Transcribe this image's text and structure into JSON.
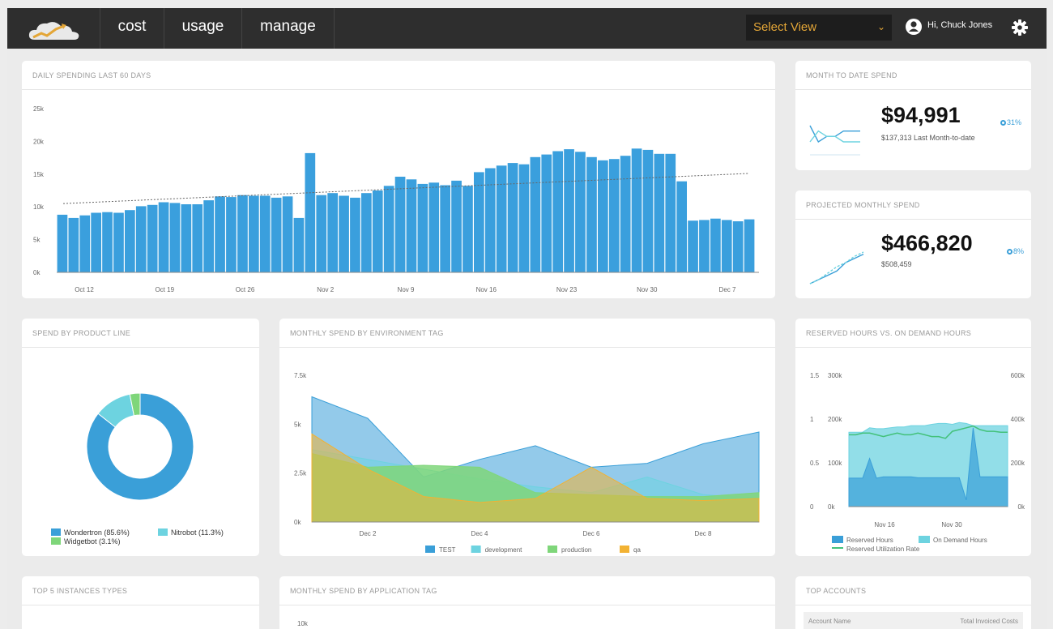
{
  "nav": {
    "items": [
      "cost",
      "usage",
      "manage"
    ],
    "select_view": "Select View",
    "user_greeting": "Hi, Chuck Jones",
    "icons": {
      "logo": "cloud-chart-logo",
      "avatar": "user-icon",
      "settings": "gear-icon",
      "dropdown": "chevron-down-icon"
    }
  },
  "cards": {
    "daily": {
      "title": "DAILY SPENDING LAST 60 DAYS"
    },
    "mtd": {
      "title": "MONTH TO DATE SPEND",
      "value": "$94,991",
      "sub": "$137,313 Last Month-to-date",
      "change": "31%"
    },
    "projected": {
      "title": "PROJECTED MONTHLY SPEND",
      "value": "$466,820",
      "sub": "$508,459",
      "change": "8%"
    },
    "product": {
      "title": "SPEND BY PRODUCT LINE"
    },
    "env": {
      "title": "MONTHLY SPEND BY ENVIRONMENT TAG"
    },
    "reserved": {
      "title": "RESERVED HOURS VS. ON DEMAND HOURS"
    },
    "instances": {
      "title": "TOP 5 INSTANCES TYPES"
    },
    "app": {
      "title": "MONTHLY SPEND BY APPLICATION TAG",
      "ytick": "10k"
    },
    "accounts": {
      "title": "TOP ACCOUNTS",
      "col1": "Account Name",
      "col2": "Total Invoiced Costs"
    }
  },
  "colors": {
    "bar": "#3a9fdd",
    "topbar": "#2e2e2e",
    "accent": "#e4a637",
    "test": "#3a9fd8",
    "development": "#6dd3e0",
    "production": "#7fd67a",
    "qa": "#f2b233"
  },
  "chart_data": [
    {
      "type": "bar",
      "title": "DAILY SPENDING LAST 60 DAYS",
      "yticks": [
        "25k",
        "20k",
        "15k",
        "10k",
        "5k",
        "0k"
      ],
      "ylim": [
        0,
        25000
      ],
      "xticks": [
        "Oct 12",
        "Oct 19",
        "Oct 26",
        "Nov 2",
        "Nov 9",
        "Nov 16",
        "Nov 23",
        "Nov 30",
        "Dec 7"
      ],
      "values": [
        8800,
        8300,
        8700,
        9100,
        9200,
        9100,
        9500,
        10100,
        10300,
        10700,
        10600,
        10400,
        10400,
        11000,
        11600,
        11500,
        11800,
        11700,
        11700,
        11400,
        11600,
        8300,
        18200,
        11800,
        12100,
        11700,
        11400,
        12100,
        12500,
        13200,
        14600,
        14200,
        13500,
        13700,
        13300,
        14000,
        13200,
        15300,
        15900,
        16300,
        16700,
        16500,
        17600,
        18000,
        18500,
        18800,
        18400,
        17600,
        17100,
        17300,
        17800,
        18900,
        18700,
        18100,
        18100,
        13900,
        7900,
        8000,
        8200,
        8000,
        7800,
        8100
      ],
      "trendline": [
        10500,
        15100
      ]
    },
    {
      "type": "line",
      "title": "MONTH TO DATE SPEND",
      "series": [
        {
          "values": [
            6,
            3,
            4,
            4,
            5,
            5,
            5
          ]
        },
        {
          "values": [
            3,
            5,
            4,
            4,
            3,
            3,
            3
          ]
        }
      ]
    },
    {
      "type": "line",
      "title": "PROJECTED MONTHLY SPEND",
      "series": [
        {
          "values": [
            1,
            2,
            3,
            4,
            6,
            7,
            8
          ]
        },
        {
          "values": [
            1,
            2,
            3.5,
            5,
            6,
            7.5,
            8.5
          ]
        }
      ]
    },
    {
      "type": "pie",
      "title": "SPEND BY PRODUCT LINE",
      "slices": [
        {
          "name": "Wondertron (85.6%)",
          "value": 85.6,
          "color": "#3a9fd8"
        },
        {
          "name": "Nitrobot (11.3%)",
          "value": 11.3,
          "color": "#6dd3e0"
        },
        {
          "name": "Widgetbot (3.1%)",
          "value": 3.1,
          "color": "#7fd67a"
        }
      ]
    },
    {
      "type": "area",
      "title": "MONTHLY SPEND BY ENVIRONMENT TAG",
      "yticks": [
        "7.5k",
        "5k",
        "2.5k",
        "0k"
      ],
      "ylim": [
        0,
        7500
      ],
      "x": [
        "Dec 1",
        "Dec 2",
        "Dec 3",
        "Dec 4",
        "Dec 5",
        "Dec 6",
        "Dec 7",
        "Dec 8",
        "Dec 9"
      ],
      "xticks": [
        "Dec 2",
        "Dec 4",
        "Dec 6",
        "Dec 8"
      ],
      "series": [
        {
          "name": "TEST",
          "color": "#3a9fd8",
          "values": [
            6400,
            5300,
            2300,
            3200,
            3900,
            2800,
            3000,
            4000,
            4600
          ]
        },
        {
          "name": "development",
          "color": "#6dd3e0",
          "values": [
            3700,
            3200,
            2700,
            2200,
            1800,
            1500,
            2300,
            1400,
            1200
          ]
        },
        {
          "name": "production",
          "color": "#7fd67a",
          "values": [
            3500,
            2800,
            2900,
            2800,
            1500,
            1400,
            1300,
            1300,
            1500
          ]
        },
        {
          "name": "qa",
          "color": "#f2b233",
          "values": [
            4500,
            2700,
            1300,
            1000,
            1200,
            2800,
            1200,
            1100,
            1200
          ]
        }
      ]
    },
    {
      "type": "area",
      "title": "RESERVED HOURS VS. ON DEMAND HOURS",
      "yticks_left_rate": [
        "1.5",
        "1",
        "0.5",
        "0"
      ],
      "yticks_left": [
        "300k",
        "200k",
        "100k",
        "0k"
      ],
      "yticks_right": [
        "600k",
        "400k",
        "200k",
        "0k"
      ],
      "xticks": [
        "Nov 16",
        "Nov 30"
      ],
      "series": [
        {
          "name": "Reserved Hours",
          "color": "#3a9fd8",
          "values": [
            65000,
            65000,
            65000,
            110000,
            65000,
            68000,
            68000,
            68000,
            68000,
            68000,
            66000,
            66000,
            66000,
            66000,
            66000,
            66000,
            66000,
            15000,
            180000,
            68000,
            68000,
            68000,
            68000,
            68000
          ]
        },
        {
          "name": "On Demand Hours",
          "color": "#6dd3e0",
          "values": [
            170000,
            170000,
            170000,
            180000,
            178000,
            178000,
            180000,
            182000,
            182000,
            185000,
            185000,
            185000,
            188000,
            190000,
            190000,
            188000,
            192000,
            190000,
            185000,
            185000,
            185000,
            185000,
            185000,
            185000
          ]
        },
        {
          "name": "Reserved Utilization Rate",
          "color": "#43c17a",
          "values": [
            0.82,
            0.82,
            0.84,
            0.84,
            0.82,
            0.8,
            0.82,
            0.84,
            0.82,
            0.82,
            0.84,
            0.82,
            0.8,
            0.8,
            0.78,
            0.86,
            0.88,
            0.9,
            0.92,
            0.88,
            0.86,
            0.86,
            0.85,
            0.85
          ]
        }
      ]
    }
  ]
}
